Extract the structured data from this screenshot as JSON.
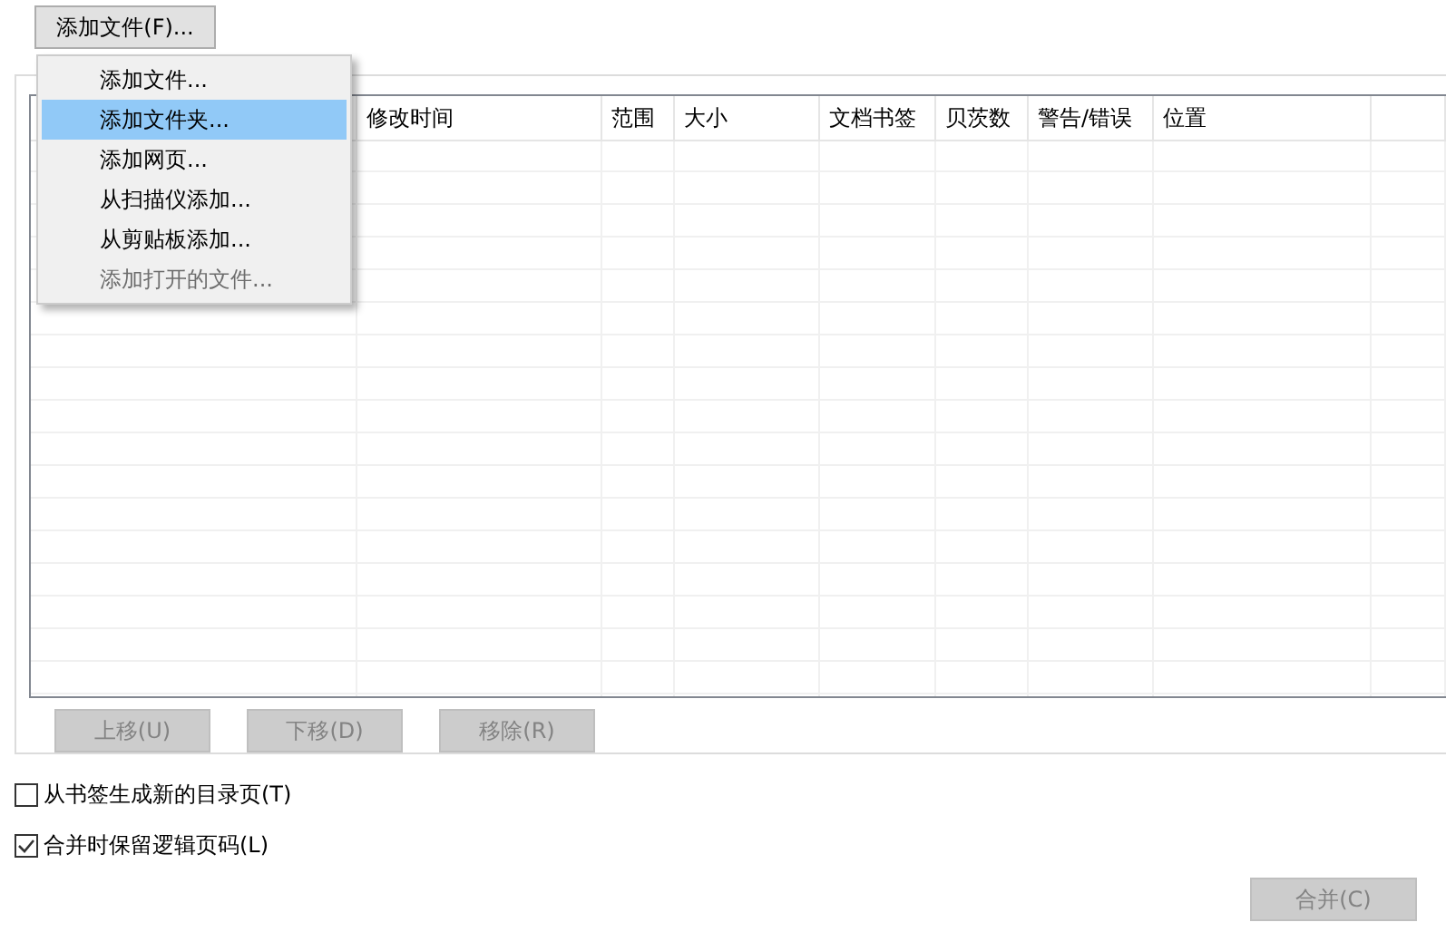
{
  "add_button": {
    "label": "添加文件(F)..."
  },
  "add_menu": {
    "items": [
      {
        "label": "添加文件...",
        "selected": false,
        "disabled": false
      },
      {
        "label": "添加文件夹...",
        "selected": true,
        "disabled": false
      },
      {
        "label": "添加网页...",
        "selected": false,
        "disabled": false
      },
      {
        "label": "从扫描仪添加...",
        "selected": false,
        "disabled": false
      },
      {
        "label": "从剪贴板添加...",
        "selected": false,
        "disabled": false
      },
      {
        "label": "添加打开的文件...",
        "selected": false,
        "disabled": true
      }
    ]
  },
  "table": {
    "columns": [
      "修改时间",
      "范围",
      "大小",
      "文档书签",
      "贝茨数",
      "警告/错误",
      "位置"
    ]
  },
  "list_buttons": [
    {
      "label": "上移(U)",
      "disabled": true
    },
    {
      "label": "下移(D)",
      "disabled": true
    },
    {
      "label": "移除(R)",
      "disabled": true
    }
  ],
  "options": [
    {
      "label": "从书签生成新的目录页(T)",
      "checked": false
    },
    {
      "label": "合并时保留逻辑页码(L)",
      "checked": true
    }
  ],
  "merge_button": {
    "label": "合并(C)",
    "disabled": true
  }
}
